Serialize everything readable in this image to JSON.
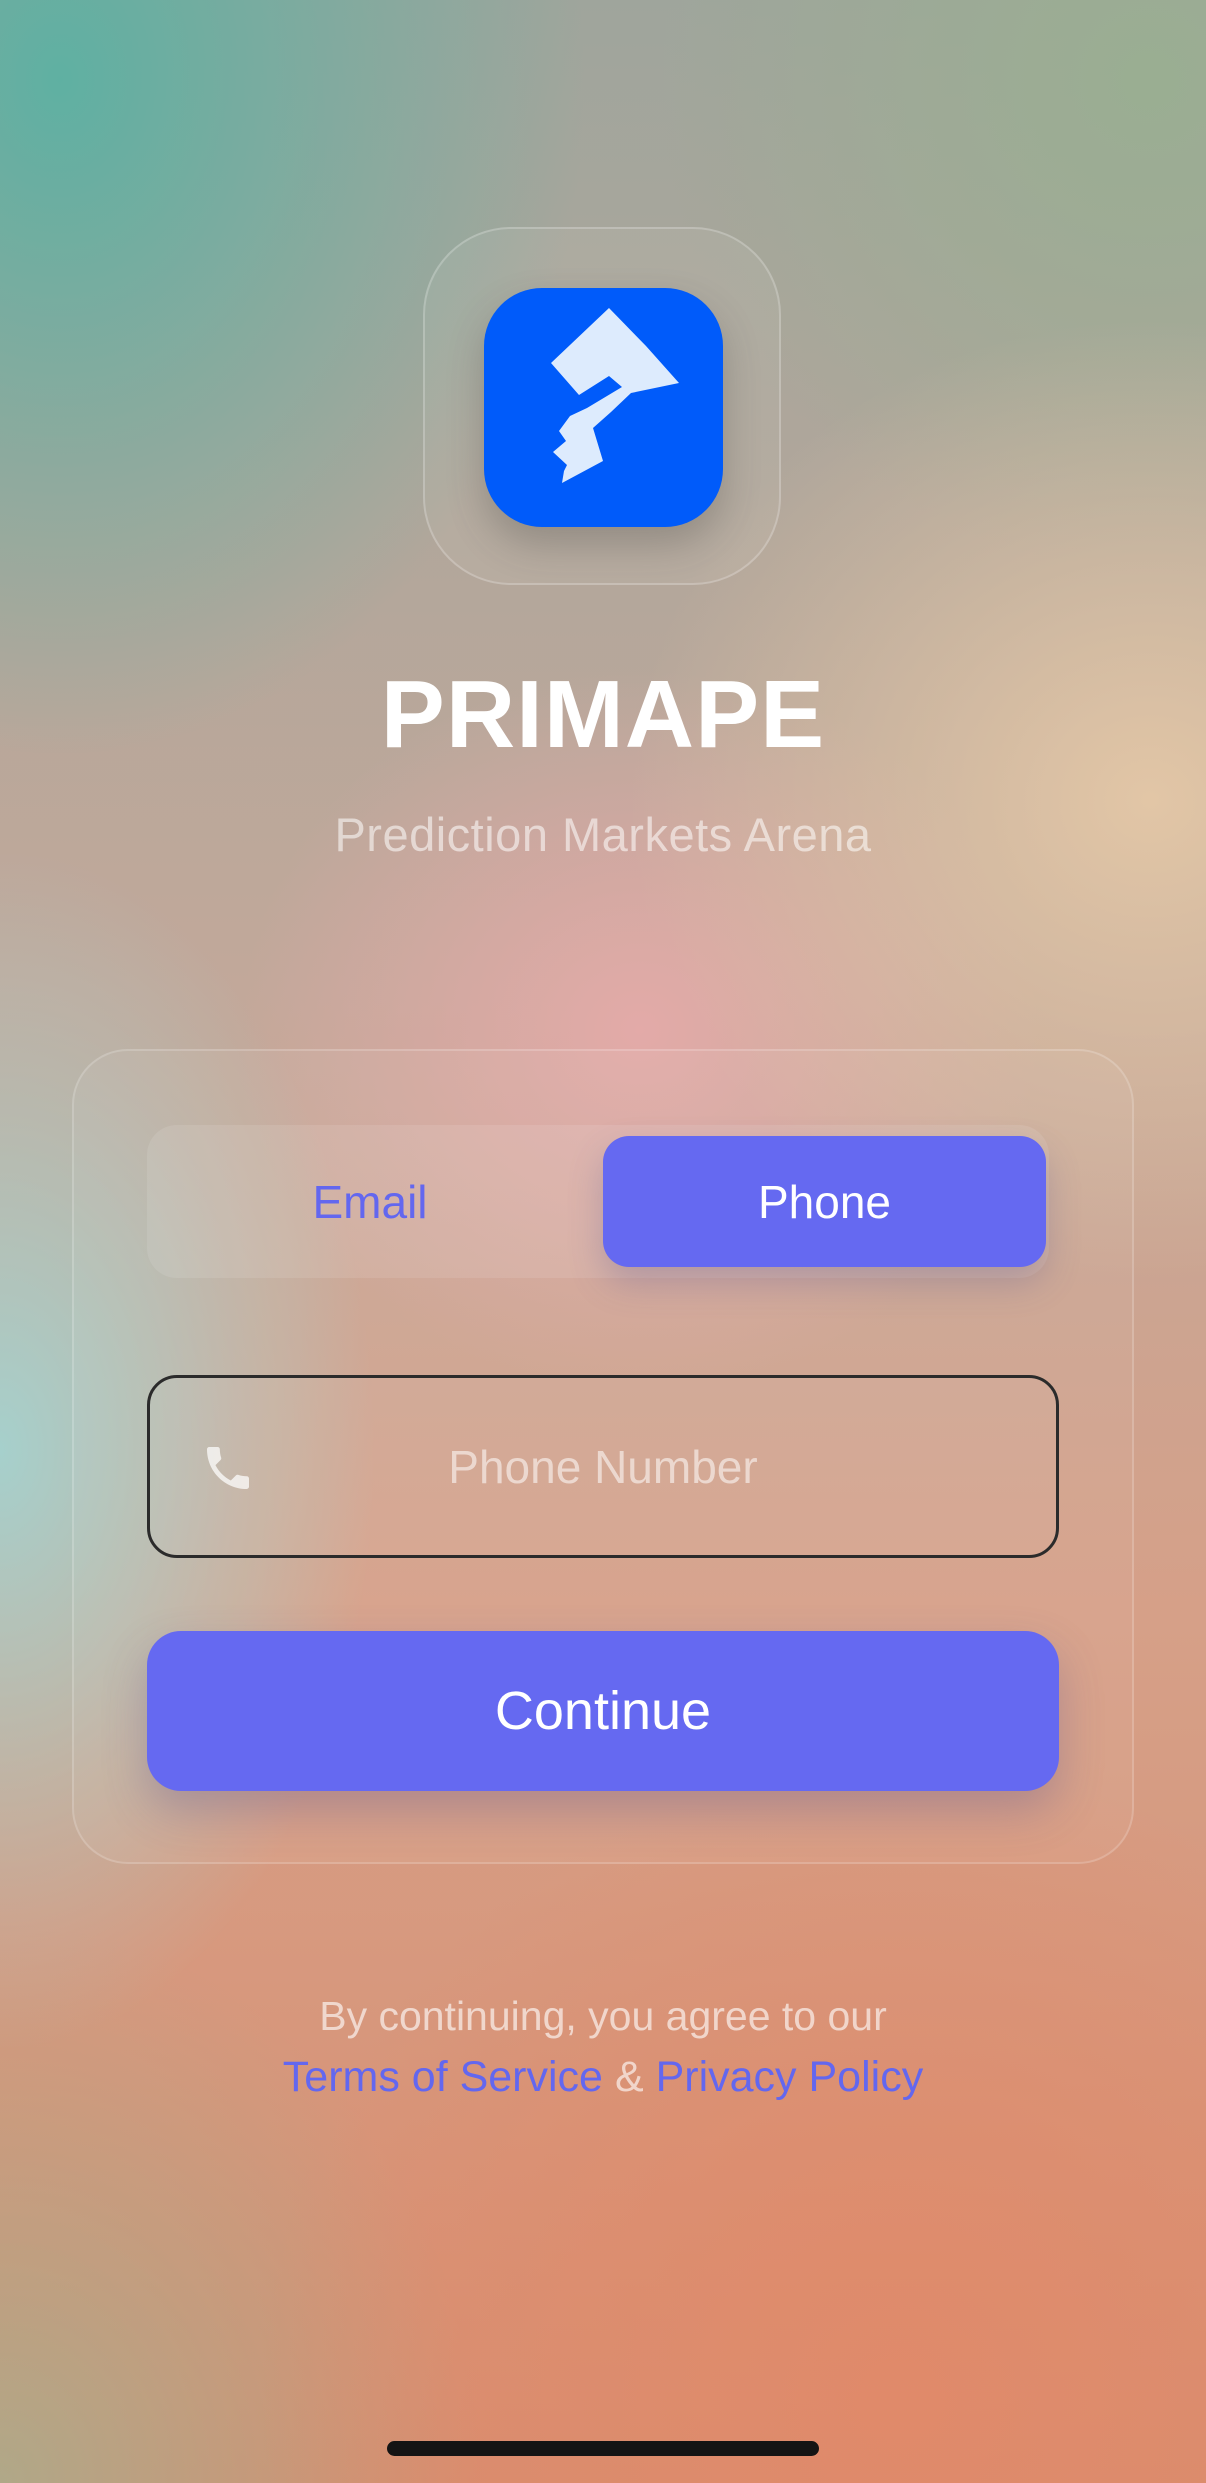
{
  "brand": {
    "name": "PRIMAPE",
    "tagline": "Prediction Markets Arena",
    "logo_icon": "primape-logo-icon",
    "logo_color": "#005bfa"
  },
  "auth": {
    "tabs": [
      {
        "label": "Email",
        "selected": false
      },
      {
        "label": "Phone",
        "selected": true
      }
    ],
    "phone_field": {
      "icon": "phone-icon",
      "placeholder": "Phone Number",
      "value": ""
    },
    "continue_label": "Continue",
    "accent_color": "#6569f1"
  },
  "legal": {
    "prefix": "By continuing, you agree to our",
    "terms_label": "Terms of Service",
    "separator": "&",
    "privacy_label": "Privacy Policy"
  }
}
